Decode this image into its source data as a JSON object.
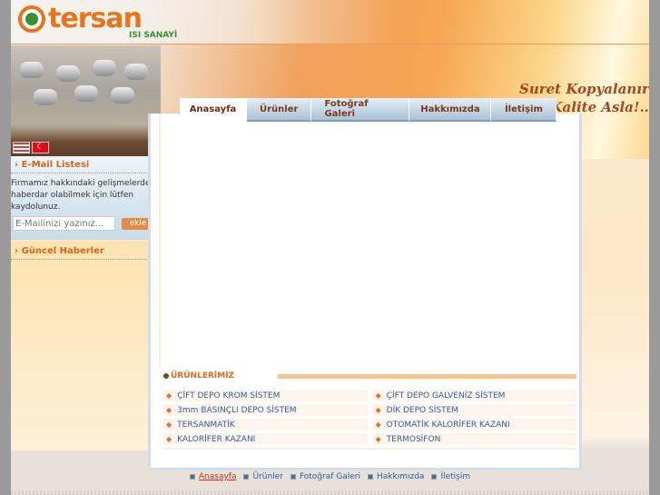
{
  "logo": {
    "name": "tersan",
    "sub": "ISI SANAYİ"
  },
  "slogan": {
    "line1": "Suret Kopyalanır",
    "line2": "Kalite Asla!.."
  },
  "nav": [
    "Anasayfa",
    "Ürünler",
    "Fotoğraf Galeri",
    "Hakkımızda",
    "İletişim"
  ],
  "sidebar": {
    "email_title": "E-Mail Listesi",
    "email_text": "Firmamız hakkındaki gelişmelerden haberdar olabilmek için lütfen kaydolunuz.",
    "email_placeholder": "E-Mailinizi yazınız...",
    "email_button": "ekle",
    "news_title": "Güncel Haberler"
  },
  "products": {
    "title": "ÜRÜNLERİMİZ",
    "items": [
      "ÇİFT DEPO KROM SİSTEM",
      "ÇİFT DEPO GALVENİZ SİSTEM",
      "3mm BASINÇLI DEPO SİSTEM",
      "DİK DEPO SİSTEM",
      "TERSANMATİK",
      "OTOMATİK KALORİFER KAZANI",
      "KALORİFER KAZANI",
      "TERMOSİFON"
    ]
  },
  "footer": [
    "Anasayfa",
    "Ürünler",
    "Fotoğraf Galeri",
    "Hakkımızda",
    "İletişim"
  ]
}
